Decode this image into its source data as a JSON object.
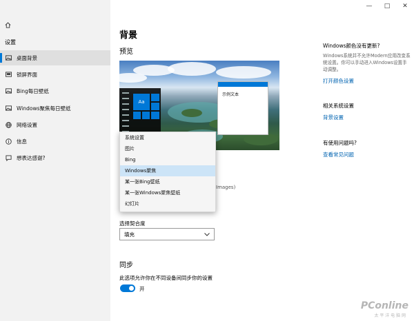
{
  "window": {
    "minimize": "—",
    "maximize": "□",
    "close": "✕"
  },
  "sidebar": {
    "home_icon": "home-icon",
    "section_title": "设置",
    "items": [
      {
        "icon": "picture-icon",
        "label": "桌面背景",
        "active": true
      },
      {
        "icon": "lockscreen-icon",
        "label": "锁屏界面"
      },
      {
        "icon": "picture-icon",
        "label": "Bing每日壁纸"
      },
      {
        "icon": "picture-icon",
        "label": "Windows聚焦每日壁纸"
      },
      {
        "icon": "globe-icon",
        "label": "网络设置"
      },
      {
        "icon": "info-icon",
        "label": "信息"
      },
      {
        "icon": "feedback-icon",
        "label": "想表达感谢?"
      }
    ]
  },
  "main": {
    "title": "背景",
    "preview_title": "预览",
    "preview_window_text": "示例文本",
    "tile_text": "Aa",
    "dropdown_options": [
      "系统设置",
      "图片",
      "Bing",
      "Windows聚焦",
      "某一张Bing壁纸",
      "某一张Windows聚焦壁纸",
      "幻灯片"
    ],
    "dropdown_selected": "Windows聚焦",
    "hidden_note": "Images)",
    "fit_label": "选择契合度",
    "fit_value": "填充",
    "sync_title": "同步",
    "sync_desc": "此选项允许你在不同设备间同步你的设置",
    "toggle_label": "开"
  },
  "right_panel": {
    "q1_title": "Windows颜色没有更新?",
    "q1_text": "Windows系统并不允许Modern应用改变系统设置。你可以手动进入Windows设置手动调整。",
    "q1_link": "打开颜色设置",
    "related_title": "相关系统设置",
    "related_link": "背景设置",
    "help_title": "有使用问题吗?",
    "help_link": "查看常见问题"
  },
  "watermark": {
    "brand": "PConline",
    "sub": "太 平 洋 电 脑 网"
  }
}
